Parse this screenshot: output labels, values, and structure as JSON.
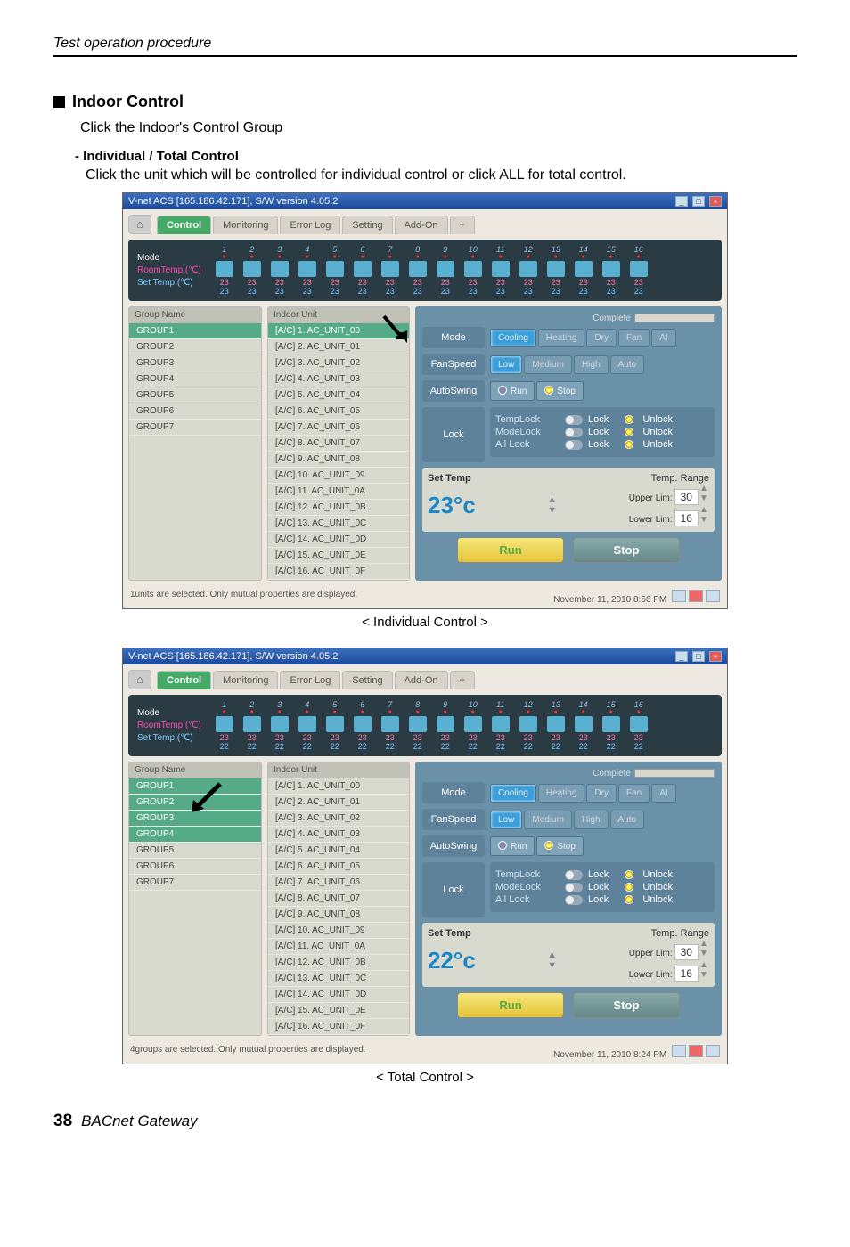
{
  "page": {
    "header": "Test operation procedure",
    "section_title": "Indoor Control",
    "body1": "Click the Indoor's Control Group",
    "sub_title": "- Individual / Total Control",
    "sub_text": "Click the unit which will be controlled for individual control or click ALL for total control.",
    "caption1": "< Individual Control >",
    "caption2": "< Total Control >",
    "pagenum": "38",
    "footer": "BACnet Gateway"
  },
  "app": {
    "title": "V-net ACS [165.186.42.171],   S/W version 4.05.2",
    "tabs": {
      "home": "⌂",
      "control": "Control",
      "monitoring": "Monitoring",
      "errorlog": "Error Log",
      "setting": "Setting",
      "addon": "Add-On",
      "plus": "+"
    },
    "summary": {
      "mode": "Mode",
      "roomtemp": "RoomTemp (℃)",
      "settemp": "Set Temp  (℃)"
    },
    "group_head": "Group Name",
    "unit_head": "Indoor Unit",
    "groups": [
      "GROUP1",
      "GROUP2",
      "GROUP3",
      "GROUP4",
      "GROUP5",
      "GROUP6",
      "GROUP7"
    ],
    "units": [
      "[A/C] 1. AC_UNIT_00",
      "[A/C] 2. AC_UNIT_01",
      "[A/C] 3. AC_UNIT_02",
      "[A/C] 4. AC_UNIT_03",
      "[A/C] 5. AC_UNIT_04",
      "[A/C] 6. AC_UNIT_05",
      "[A/C] 7. AC_UNIT_06",
      "[A/C] 8. AC_UNIT_07",
      "[A/C] 9. AC_UNIT_08",
      "[A/C] 10. AC_UNIT_09",
      "[A/C] 11. AC_UNIT_0A",
      "[A/C] 12. AC_UNIT_0B",
      "[A/C] 13. AC_UNIT_0C",
      "[A/C] 14. AC_UNIT_0D",
      "[A/C] 15. AC_UNIT_0E",
      "[A/C] 16. AC_UNIT_0F"
    ],
    "complete": "Complete",
    "ctrl": {
      "mode": "Mode",
      "cooling": "Cooling",
      "heating": "Heating",
      "dry": "Dry",
      "fan": "Fan",
      "ai": "AI",
      "fanspeed": "FanSpeed",
      "low": "Low",
      "medium": "Medium",
      "high": "High",
      "auto": "Auto",
      "autoswing": "AutoSwing",
      "run": "Run",
      "stop": "Stop",
      "lock": "Lock",
      "templock": "TempLock",
      "modelock": "ModeLock",
      "alllock": "All Lock",
      "lockv": "Lock",
      "unlock": "Unlock",
      "settemp": "Set Temp",
      "temprange": "Temp. Range",
      "upperlim": "Upper Lim:",
      "lowerlim": "Lower Lim:",
      "upper": "30",
      "lower": "16"
    },
    "status1": {
      "left": "1units are selected. Only mutual properties are displayed.",
      "right": "November 11, 2010  8:56 PM",
      "temp": "23"
    },
    "status2": {
      "left": "4groups are selected. Only mutual properties are displayed.",
      "right": "November 11, 2010  8:24 PM",
      "temp": "22"
    },
    "strip1": {
      "rt": "23",
      "st": "23"
    },
    "strip2": {
      "rt": "23",
      "st": "22"
    },
    "bigtemp1": "23°c",
    "bigtemp2": "22°c"
  }
}
